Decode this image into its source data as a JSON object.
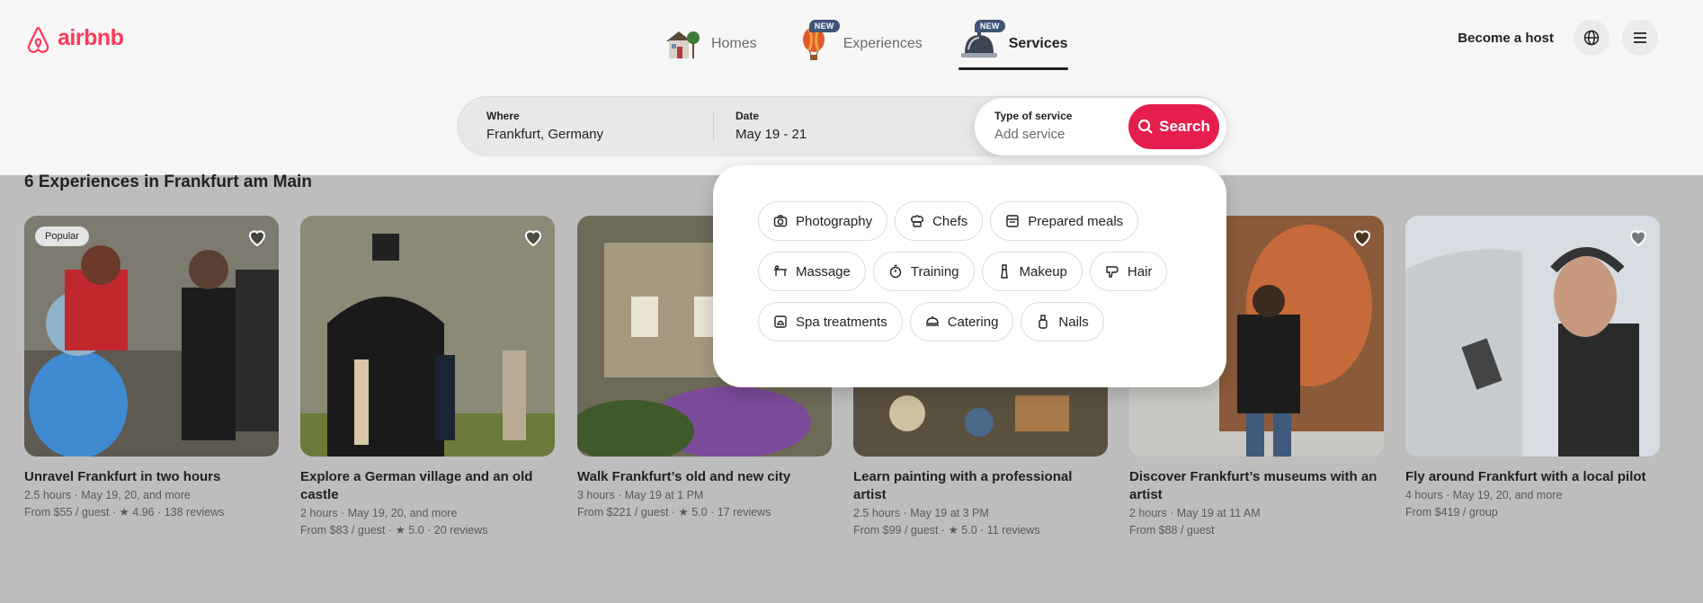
{
  "brand": {
    "name": "airbnb",
    "color": "#ff385c"
  },
  "nav": {
    "items": [
      {
        "label": "Homes",
        "icon": "house-icon",
        "badge": ""
      },
      {
        "label": "Experiences",
        "icon": "hot-air-balloon-icon",
        "badge": "NEW"
      },
      {
        "label": "Services",
        "icon": "service-bell-icon",
        "badge": "NEW",
        "active": true
      }
    ]
  },
  "header": {
    "become_host": "Become a host",
    "globe_icon": "globe-icon",
    "menu_icon": "hamburger-menu-icon"
  },
  "search": {
    "where_label": "Where",
    "where_value": "Frankfurt, Germany",
    "date_label": "Date",
    "date_value": "May 19 - 21",
    "type_label": "Type of service",
    "type_placeholder": "Add service",
    "button_label": "Search",
    "button_color": "#e61e4d"
  },
  "service_menu": {
    "rows": [
      [
        {
          "label": "Photography",
          "icon": "camera-icon"
        },
        {
          "label": "Chefs",
          "icon": "chef-hat-icon"
        },
        {
          "label": "Prepared meals",
          "icon": "meal-box-icon"
        }
      ],
      [
        {
          "label": "Massage",
          "icon": "massage-table-icon"
        },
        {
          "label": "Training",
          "icon": "stopwatch-icon"
        },
        {
          "label": "Makeup",
          "icon": "makeup-brush-icon"
        },
        {
          "label": "Hair",
          "icon": "hair-dryer-icon"
        }
      ],
      [
        {
          "label": "Spa treatments",
          "icon": "spa-icon"
        },
        {
          "label": "Catering",
          "icon": "catering-icon"
        },
        {
          "label": "Nails",
          "icon": "nail-polish-icon"
        }
      ]
    ]
  },
  "results": {
    "title": "6 Experiences in Frankfurt am Main",
    "cards": [
      {
        "title": "Unravel Frankfurt in two hours",
        "badge": "Popular",
        "line1": "2.5 hours · May 19, 20, and more",
        "line2": "From $55 / guest · ★ 4.96 · 138 reviews",
        "line3": ""
      },
      {
        "title": "Explore a German village and an old castle",
        "badge": "",
        "line1": "2 hours · May 19, 20, and more",
        "line2": "From $83 / guest · ★ 5.0 · 20 reviews",
        "line3": ""
      },
      {
        "title": "Walk Frankfurt’s old and new city",
        "badge": "",
        "line1": "3 hours · May 19 at 1 PM",
        "line2": "From $221 / guest · ★ 5.0 · 17 reviews",
        "line3": ""
      },
      {
        "title": "Learn painting with a professional artist",
        "badge": "",
        "line1": "2.5 hours · May 19 at 3 PM",
        "line2": "From $99 / guest · ★ 5.0 · 11 reviews",
        "line3": ""
      },
      {
        "title": "Discover Frankfurt’s museums with an artist",
        "badge": "",
        "line1": "2 hours · May 19 at 11 AM",
        "line2": "From $88 / guest",
        "line3": ""
      },
      {
        "title": "Fly around Frankfurt with a local pilot",
        "badge": "",
        "line1": "4 hours · May 19, 20, and more",
        "line2": "From $419 / group",
        "line3": ""
      }
    ]
  }
}
